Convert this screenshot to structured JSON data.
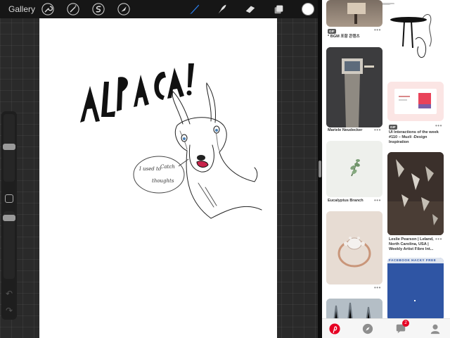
{
  "procreate": {
    "gallery_label": "Gallery",
    "tools": [
      "wrench-icon",
      "magic-wand-icon",
      "selection-icon",
      "transform-icon",
      "brush-icon",
      "smudge-icon",
      "eraser-icon",
      "layers-icon"
    ],
    "active_tool": "brush-icon",
    "current_color": "#ffffff",
    "canvas": {
      "title_text": "ALPACA!",
      "speech_bubble_text": [
        "I used to",
        "Catch",
        "thoughts"
      ]
    }
  },
  "pinterest": {
    "pins": [
      {
        "id": "pin-1",
        "title": "* BGM 포함 콘텐츠",
        "badge": "GIF"
      },
      {
        "id": "pin-2",
        "title": ""
      },
      {
        "id": "pin-3",
        "title": "Mariele Neudecker"
      },
      {
        "id": "pin-4",
        "title": "UI Interactions of the week #110 – Muzli -Design Inspiration",
        "badge": "GIF"
      },
      {
        "id": "pin-5",
        "title": "Eucalyptus Branch"
      },
      {
        "id": "pin-6",
        "title": "Leslie Pearson | Leland, North Carolina, USA | Weekly Artist Fibre Int..."
      },
      {
        "id": "pin-7",
        "title": ""
      },
      {
        "id": "pin-8",
        "title": "FACEBOOK HACKY FREE"
      },
      {
        "id": "pin-9",
        "title": ""
      }
    ],
    "notification_count": "2",
    "tabs": [
      "pinterest-home-icon",
      "compass-icon",
      "chat-icon",
      "profile-icon"
    ],
    "brand_color": "#e60023"
  }
}
